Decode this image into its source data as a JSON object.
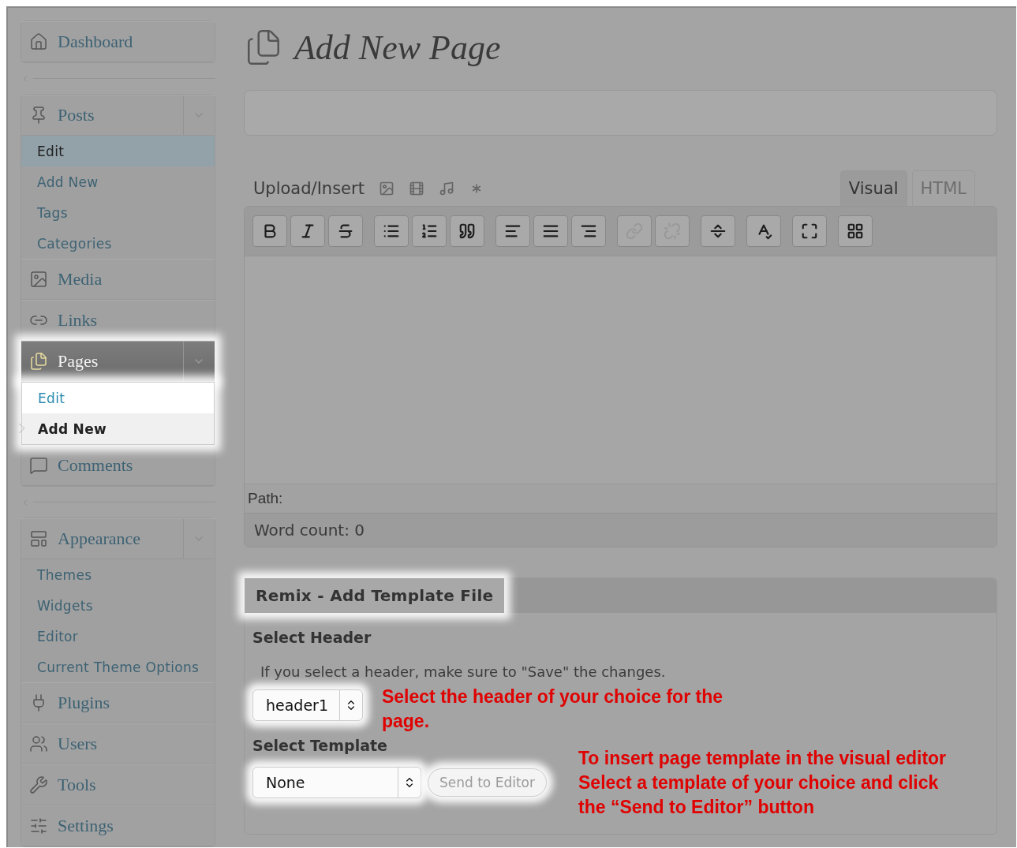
{
  "sidebar": {
    "menus": [
      {
        "items": [
          {
            "label": "Dashboard",
            "spotlight": false
          }
        ]
      },
      {
        "items": [
          {
            "label": "Posts",
            "spotlight": false,
            "expanded": true,
            "submenu": [
              {
                "label": "Edit",
                "selected": true
              },
              {
                "label": "Add New",
                "selected": false
              },
              {
                "label": "Tags",
                "selected": false
              },
              {
                "label": "Categories",
                "selected": false
              }
            ]
          },
          {
            "label": "Media",
            "spotlight": false
          },
          {
            "label": "Links",
            "spotlight": false
          },
          {
            "label": "Pages",
            "spotlight": true,
            "expanded": true,
            "submenu": [
              {
                "label": "Edit",
                "selected": false
              },
              {
                "label": "Add New",
                "selected": true
              }
            ]
          },
          {
            "label": "Comments",
            "spotlight": false
          }
        ]
      },
      {
        "items": [
          {
            "label": "Appearance",
            "spotlight": false,
            "expanded": true,
            "submenu": [
              {
                "label": "Themes",
                "selected": false
              },
              {
                "label": "Widgets",
                "selected": false
              },
              {
                "label": "Editor",
                "selected": false
              },
              {
                "label": "Current Theme Options",
                "selected": false
              }
            ]
          },
          {
            "label": "Plugins",
            "spotlight": false
          },
          {
            "label": "Users",
            "spotlight": false
          },
          {
            "label": "Tools",
            "spotlight": false
          },
          {
            "label": "Settings",
            "spotlight": false
          }
        ]
      }
    ]
  },
  "page": {
    "title": "Add New Page"
  },
  "editor": {
    "upload_label": "Upload/Insert",
    "tabs": [
      {
        "label": "Visual",
        "selected": true
      },
      {
        "label": "HTML",
        "selected": false
      }
    ],
    "toolbar": [
      {
        "disabled": false
      },
      {
        "disabled": false
      },
      {
        "disabled": false
      },
      {
        "disabled": false
      },
      {
        "disabled": false
      },
      {
        "disabled": false
      },
      {
        "disabled": false
      },
      {
        "disabled": false
      },
      {
        "disabled": false
      },
      {
        "disabled": true
      },
      {
        "disabled": true
      },
      {
        "disabled": false
      },
      {
        "disabled": false
      },
      {
        "disabled": false
      },
      {
        "disabled": false
      }
    ],
    "path_label": "Path:",
    "word_count": "Word count: 0"
  },
  "template_box": {
    "title": "Remix - Add Template File",
    "title_spotlight": true,
    "header_label": "Select Header",
    "hint": "If you select a header, make sure to \"Save\" the changes.",
    "header_select": {
      "value": "header1",
      "spotlight": true
    },
    "header_note": "Select the header of your choice for the page.",
    "template_label": "Select Template",
    "template_select": {
      "value": "None",
      "spotlight": true
    },
    "send_button": {
      "label": "Send to Editor",
      "disabled": true
    },
    "template_note": [
      "To insert page template in the visual editor",
      "Select a template of your choice and click",
      "the “Send to Editor” button"
    ]
  }
}
